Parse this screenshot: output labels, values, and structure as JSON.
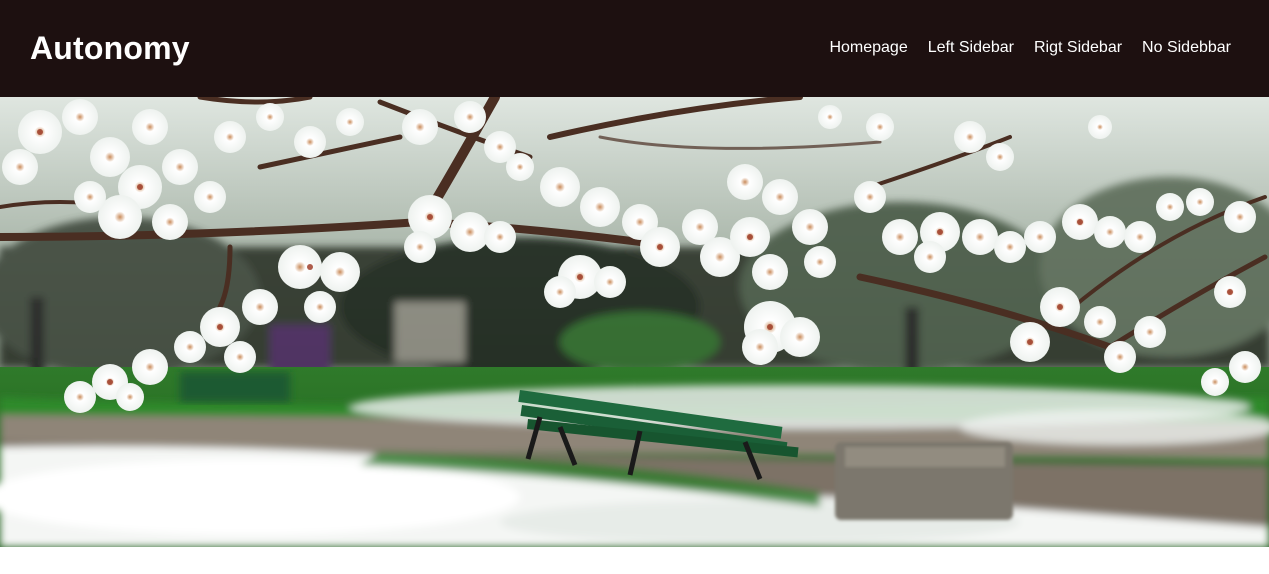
{
  "header": {
    "brand": "Autonomy",
    "nav": [
      {
        "label": "Homepage"
      },
      {
        "label": "Left Sidebar"
      },
      {
        "label": "Rigt Sidebar"
      },
      {
        "label": "No Sidebbar"
      }
    ]
  },
  "hero": {
    "icon": "blossom-park-photo"
  },
  "colors": {
    "header_bg": "#1d1010",
    "text": "#ffffff"
  }
}
